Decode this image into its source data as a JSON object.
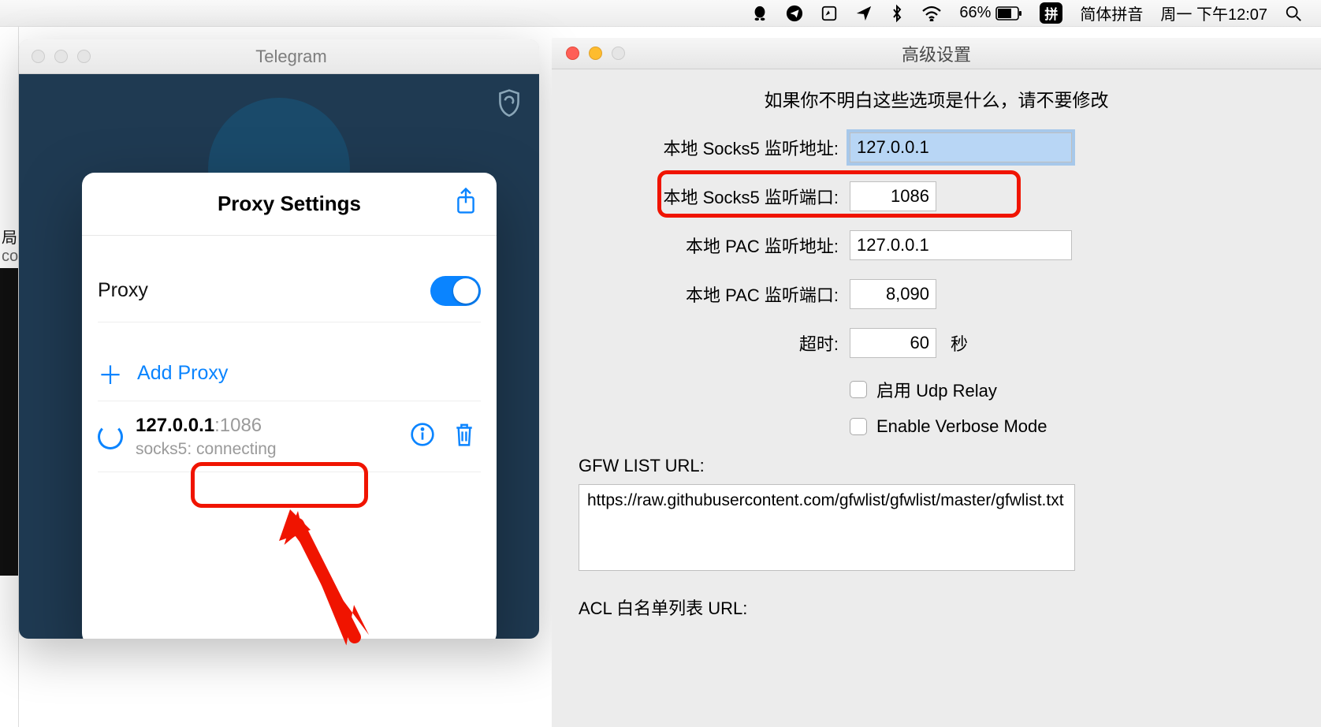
{
  "menubar": {
    "battery_pct": "66%",
    "ime_badge": "拼",
    "ime_name": "简体拼音",
    "clock": "周一 下午12:07"
  },
  "left_edge": {
    "frag1": "局",
    "frag2": "co"
  },
  "telegram": {
    "window_title": "Telegram",
    "card_title": "Proxy Settings",
    "proxy_label": "Proxy",
    "add_proxy": "Add Proxy",
    "entry_host": "127.0.0.1",
    "entry_port": ":1086",
    "entry_status": "socks5: connecting"
  },
  "advanced": {
    "window_title": "高级设置",
    "warning": "如果你不明白这些选项是什么，请不要修改",
    "socks5_addr_label": "本地 Socks5 监听地址:",
    "socks5_addr_value": "127.0.0.1",
    "socks5_port_label": "本地 Socks5 监听端口:",
    "socks5_port_value": "1086",
    "pac_addr_label": "本地 PAC 监听地址:",
    "pac_addr_value": "127.0.0.1",
    "pac_port_label": "本地 PAC 监听端口:",
    "pac_port_value": "8,090",
    "timeout_label": "超时:",
    "timeout_value": "60",
    "timeout_unit": "秒",
    "udp_relay_label": "启用 Udp Relay",
    "verbose_label": "Enable Verbose Mode",
    "gfw_label": "GFW LIST URL:",
    "gfw_value": "https://raw.githubusercontent.com/gfwlist/gfwlist/master/gfwlist.txt",
    "acl_label": "ACL 白名单列表 URL:"
  }
}
